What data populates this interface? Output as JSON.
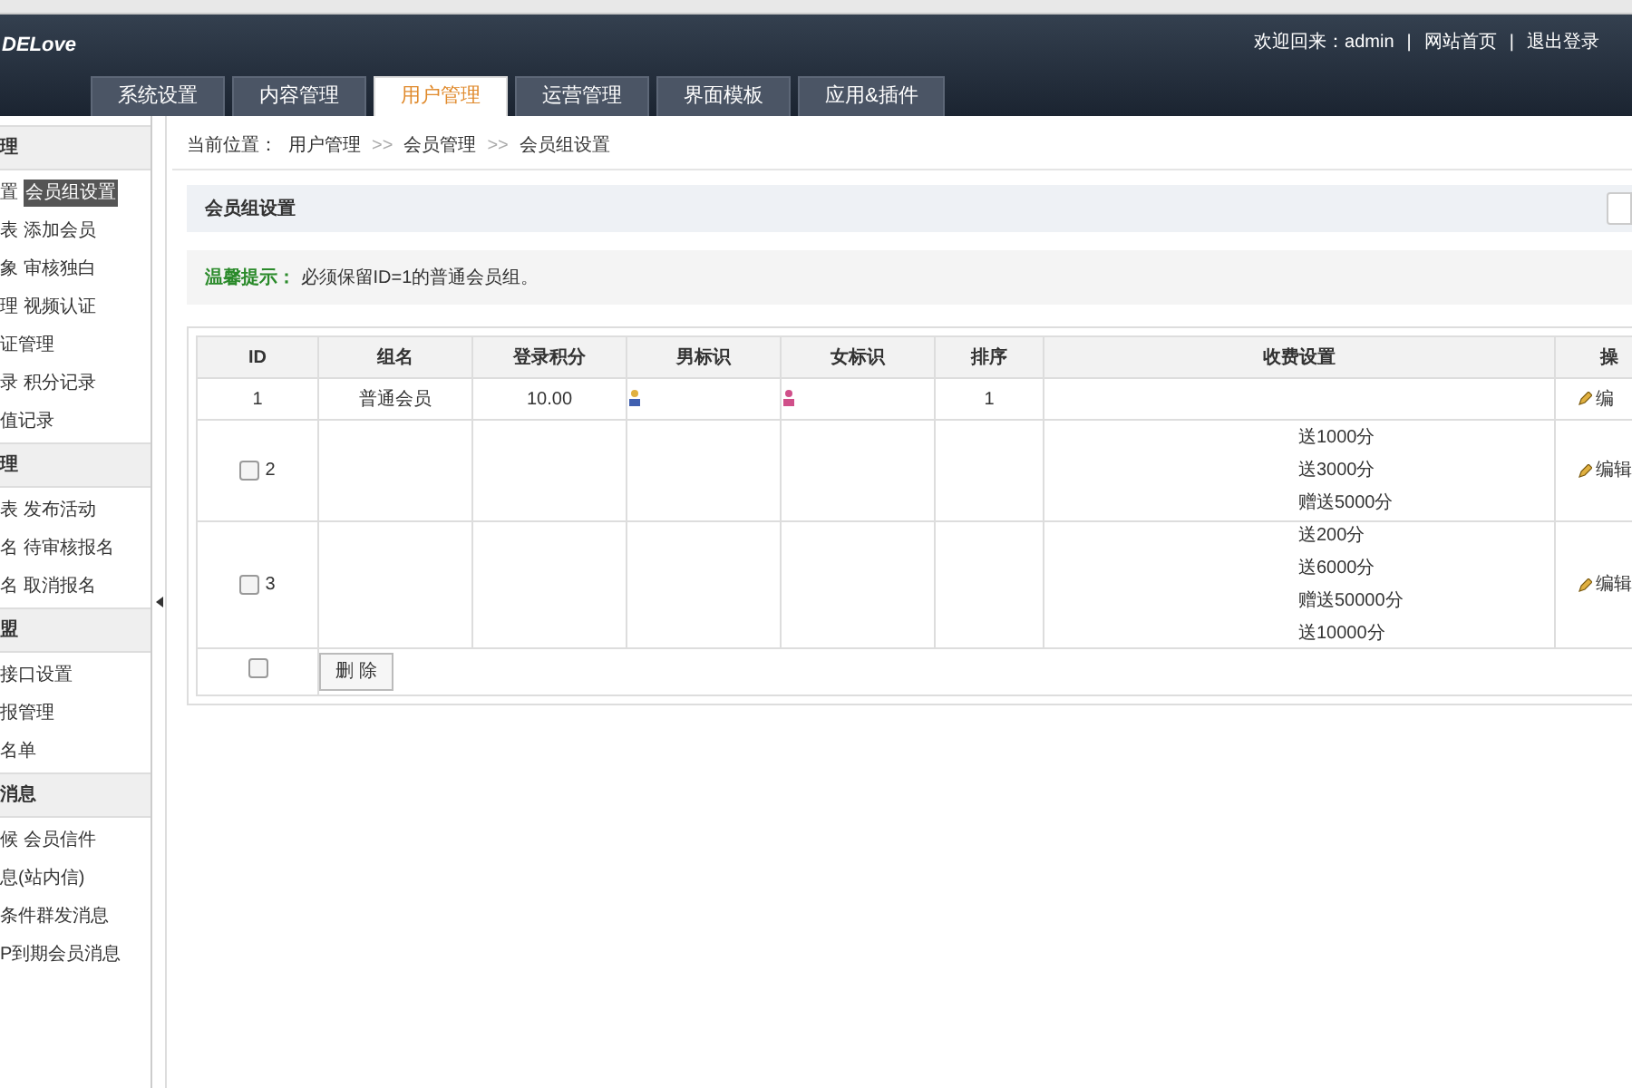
{
  "header": {
    "logo": "DELove",
    "user_links": [
      {
        "text": "欢迎回来：admin"
      },
      {
        "text": "网站首页"
      },
      {
        "text": "退出登录"
      }
    ],
    "separator": "|"
  },
  "tabs": [
    {
      "label": "系统设置",
      "selected": false
    },
    {
      "label": "内容管理",
      "selected": false
    },
    {
      "label": "用户管理",
      "selected": true
    },
    {
      "label": "运营管理",
      "selected": false
    },
    {
      "label": "界面模板",
      "selected": false
    },
    {
      "label": "应用&插件",
      "selected": false
    }
  ],
  "sidebar": [
    {
      "title": "理",
      "rows": [
        [
          {
            "text": "置",
            "selected": false
          },
          {
            "text": "会员组设置",
            "selected": true
          }
        ],
        [
          {
            "text": "表",
            "selected": false
          },
          {
            "text": "添加会员",
            "selected": false
          }
        ],
        [
          {
            "text": "象",
            "selected": false
          },
          {
            "text": "审核独白",
            "selected": false
          }
        ],
        [
          {
            "text": "理",
            "selected": false
          },
          {
            "text": "视频认证",
            "selected": false
          }
        ],
        [
          {
            "text": "证管理",
            "selected": false
          }
        ],
        [
          {
            "text": "录",
            "selected": false
          },
          {
            "text": "积分记录",
            "selected": false
          }
        ],
        [
          {
            "text": "值记录",
            "selected": false
          }
        ]
      ]
    },
    {
      "title": "理",
      "rows": [
        [
          {
            "text": "表",
            "selected": false
          },
          {
            "text": "发布活动",
            "selected": false
          }
        ],
        [
          {
            "text": "名",
            "selected": false
          },
          {
            "text": "待审核报名",
            "selected": false
          }
        ],
        [
          {
            "text": "名",
            "selected": false
          },
          {
            "text": "取消报名",
            "selected": false
          }
        ]
      ]
    },
    {
      "title": "盟",
      "rows": [
        [
          {
            "text": "接口设置",
            "selected": false
          }
        ],
        [
          {
            "text": "报管理",
            "selected": false
          }
        ],
        [
          {
            "text": "名单",
            "selected": false
          }
        ]
      ]
    },
    {
      "title": "消息",
      "rows": [
        [
          {
            "text": "候",
            "selected": false
          },
          {
            "text": "会员信件",
            "selected": false
          }
        ],
        [
          {
            "text": "息(站内信)",
            "selected": false
          }
        ],
        [
          {
            "text": "条件群发消息",
            "selected": false
          }
        ],
        [
          {
            "text": "P到期会员消息",
            "selected": false
          }
        ]
      ]
    }
  ],
  "breadcrumb": {
    "label": "当前位置：",
    "items": [
      "用户管理",
      "会员管理",
      "会员组设置"
    ],
    "separator": ">>"
  },
  "panel_title": "会员组设置",
  "tip": {
    "label": "温馨提示：",
    "text": "必须保留ID=1的普通会员组。"
  },
  "table": {
    "columns": [
      "ID",
      "组名",
      "登录积分",
      "男标识",
      "女标识",
      "排序",
      "收费设置",
      "操"
    ],
    "rows": [
      {
        "kind": "plain",
        "id": "1",
        "name": "普通会员",
        "points": "10.00",
        "order": "1",
        "fees": [],
        "action": "编"
      },
      {
        "kind": "checkbox",
        "checked": false,
        "id": "2",
        "fees": [
          "送1000分",
          "送3000分",
          "赠送5000分"
        ],
        "action": "编辑"
      },
      {
        "kind": "checkbox",
        "checked": false,
        "id": "3",
        "fees": [
          "送200分",
          "送6000分",
          "赠送50000分",
          "送10000分"
        ],
        "action": "编辑"
      }
    ],
    "footer": {
      "checked": false,
      "button": "删 除"
    }
  }
}
